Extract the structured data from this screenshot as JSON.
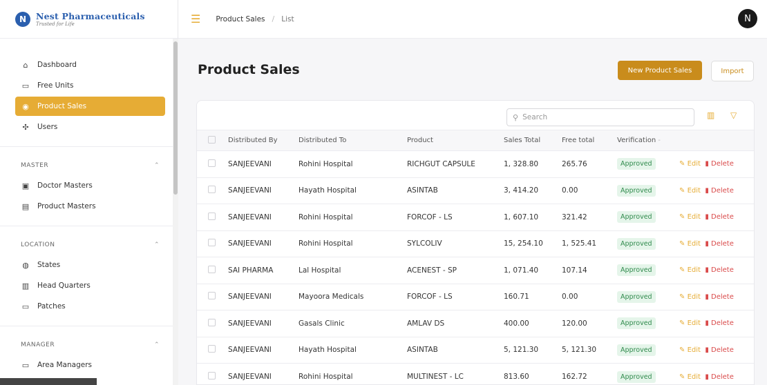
{
  "brand": {
    "name": "Nest Pharmaceuticals",
    "tagline": "Trusted for Life",
    "logo_letter": "N"
  },
  "sidebar": {
    "main": [
      {
        "label": "Dashboard",
        "icon": "home-icon",
        "glyph": "⌂"
      },
      {
        "label": "Free Units",
        "icon": "printer-icon",
        "glyph": "▭"
      },
      {
        "label": "Product Sales",
        "icon": "coin-icon",
        "glyph": "◉",
        "active": true
      },
      {
        "label": "Users",
        "icon": "users-icon",
        "glyph": "✣"
      }
    ],
    "sections": [
      {
        "title": "MASTER",
        "items": [
          {
            "label": "Doctor Masters",
            "icon": "clipboard-icon",
            "glyph": "▣"
          },
          {
            "label": "Product Masters",
            "icon": "box-icon",
            "glyph": "▤"
          }
        ]
      },
      {
        "title": "LOCATION",
        "items": [
          {
            "label": "States",
            "icon": "globe-icon",
            "glyph": "◍"
          },
          {
            "label": "Head Quarters",
            "icon": "building-icon",
            "glyph": "▥"
          },
          {
            "label": "Patches",
            "icon": "printer-icon",
            "glyph": "▭"
          }
        ]
      },
      {
        "title": "MANAGER",
        "items": [
          {
            "label": "Area Managers",
            "icon": "printer-icon",
            "glyph": "▭"
          }
        ]
      }
    ]
  },
  "topbar": {
    "crumb_1": "Product Sales",
    "crumb_2": "List",
    "avatar_letter": "N"
  },
  "main": {
    "title": "Product Sales",
    "new_button": "New Product Sales",
    "import_button": "Import",
    "search_placeholder": "Search"
  },
  "table": {
    "columns": [
      "Distributed By",
      "Distributed To",
      "Product",
      "Sales Total",
      "Free total",
      "Verification"
    ],
    "edit_label": "Edit",
    "delete_label": "Delete",
    "rows": [
      [
        "SANJEEVANI",
        "Rohini Hospital",
        "RICHGUT CAPSULE",
        "1, 328.80",
        "265.76",
        "Approved"
      ],
      [
        "SANJEEVANI",
        "Hayath Hospital",
        "ASINTAB",
        "3, 414.20",
        "0.00",
        "Approved"
      ],
      [
        "SANJEEVANI",
        "Rohini Hospital",
        "FORCOF - LS",
        "1, 607.10",
        "321.42",
        "Approved"
      ],
      [
        "SANJEEVANI",
        "Rohini Hospital",
        "SYLCOLIV",
        "15, 254.10",
        "1, 525.41",
        "Approved"
      ],
      [
        "SAI PHARMA",
        "Lal Hospital",
        "ACENEST - SP",
        "1, 071.40",
        "107.14",
        "Approved"
      ],
      [
        "SANJEEVANI",
        "Mayoora Medicals",
        "FORCOF - LS",
        "160.71",
        "0.00",
        "Approved"
      ],
      [
        "SANJEEVANI",
        "Gasals Clinic",
        "AMLAV DS",
        "400.00",
        "120.00",
        "Approved"
      ],
      [
        "SANJEEVANI",
        "Hayath Hospital",
        "ASINTAB",
        "5, 121.30",
        "5, 121.30",
        "Approved"
      ],
      [
        "SANJEEVANI",
        "Rohini Hospital",
        "MULTINEST - LC",
        "813.60",
        "162.72",
        "Approved"
      ]
    ]
  },
  "colors": {
    "accent": "#e6ac35",
    "primary_button": "#c98c1c",
    "approved_text": "#2f8a4c",
    "delete": "#d94a4a"
  }
}
